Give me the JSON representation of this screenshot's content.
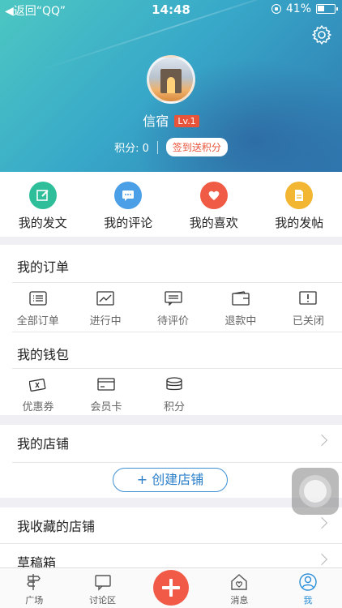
{
  "status_bar": {
    "back_label": "◀返回“QQ”",
    "time": "14:48",
    "battery": "41%"
  },
  "profile": {
    "name": "信宿",
    "level": "Lv.1",
    "points_label": "积分: 0",
    "checkin_label": "签到送积分"
  },
  "quick_actions": [
    {
      "label": "我的发文",
      "icon": "edit-icon",
      "color": "#2ebf9a"
    },
    {
      "label": "我的评论",
      "icon": "comment-icon",
      "color": "#4a9fe6"
    },
    {
      "label": "我的喜欢",
      "icon": "heart-icon",
      "color": "#ef5b45"
    },
    {
      "label": "我的发帖",
      "icon": "document-icon",
      "color": "#f2b632"
    }
  ],
  "orders": {
    "title": "我的订单",
    "items": [
      {
        "label": "全部订单",
        "icon": "list-icon"
      },
      {
        "label": "进行中",
        "icon": "trend-icon"
      },
      {
        "label": "待评价",
        "icon": "message-icon"
      },
      {
        "label": "退款中",
        "icon": "wallet-icon"
      },
      {
        "label": "已关闭",
        "icon": "alert-icon"
      }
    ]
  },
  "wallet": {
    "title": "我的钱包",
    "items": [
      {
        "label": "优惠券",
        "icon": "coupon-icon"
      },
      {
        "label": "会员卡",
        "icon": "card-icon"
      },
      {
        "label": "积分",
        "icon": "coins-icon"
      }
    ]
  },
  "store": {
    "title": "我的店铺",
    "create_label": "+ 创建店铺"
  },
  "favorites": {
    "title": "我收藏的店铺"
  },
  "drafts": {
    "title": "草稿箱"
  },
  "tabs": [
    {
      "label": "广场",
      "icon": "signpost-icon"
    },
    {
      "label": "讨论区",
      "icon": "chat-icon"
    },
    {
      "label": "",
      "icon": "plus-icon"
    },
    {
      "label": "消息",
      "icon": "home-heart-icon"
    },
    {
      "label": "我",
      "icon": "user-icon"
    }
  ],
  "colors": {
    "accent": "#2a8fd8",
    "brand_red": "#f25a48",
    "header_start": "#4dc7c2",
    "header_end": "#2f79b0"
  }
}
